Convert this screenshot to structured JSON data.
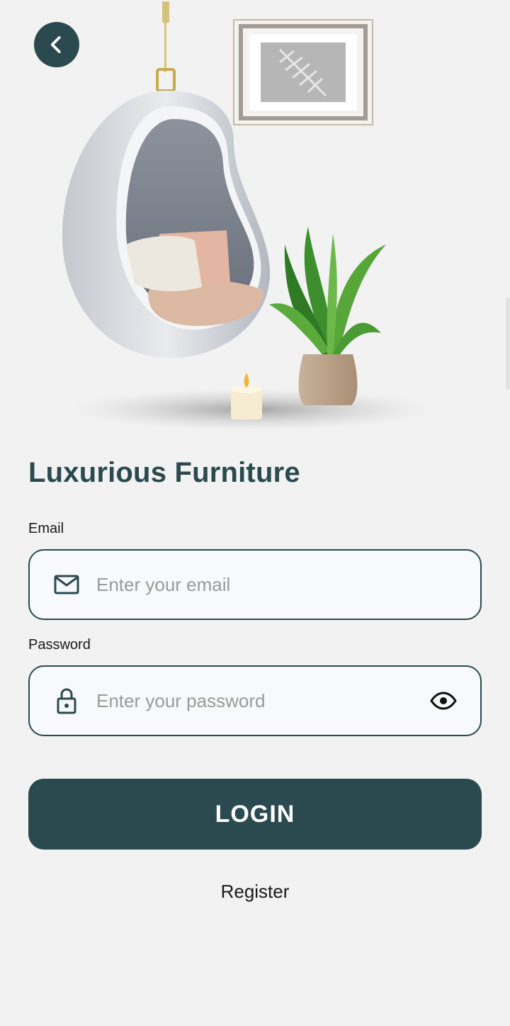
{
  "header": {
    "back_icon": "chevron-left-icon"
  },
  "brand": {
    "title": "Luxurious Furniture",
    "accent": "#2b4a4f"
  },
  "form": {
    "email": {
      "label": "Email",
      "placeholder": "Enter your email",
      "icon": "mail-icon"
    },
    "password": {
      "label": "Password",
      "placeholder": "Enter your password",
      "icon": "lock-icon",
      "toggle_icon": "eye-icon"
    },
    "login_label": "LOGIN",
    "register_label": "Register"
  }
}
